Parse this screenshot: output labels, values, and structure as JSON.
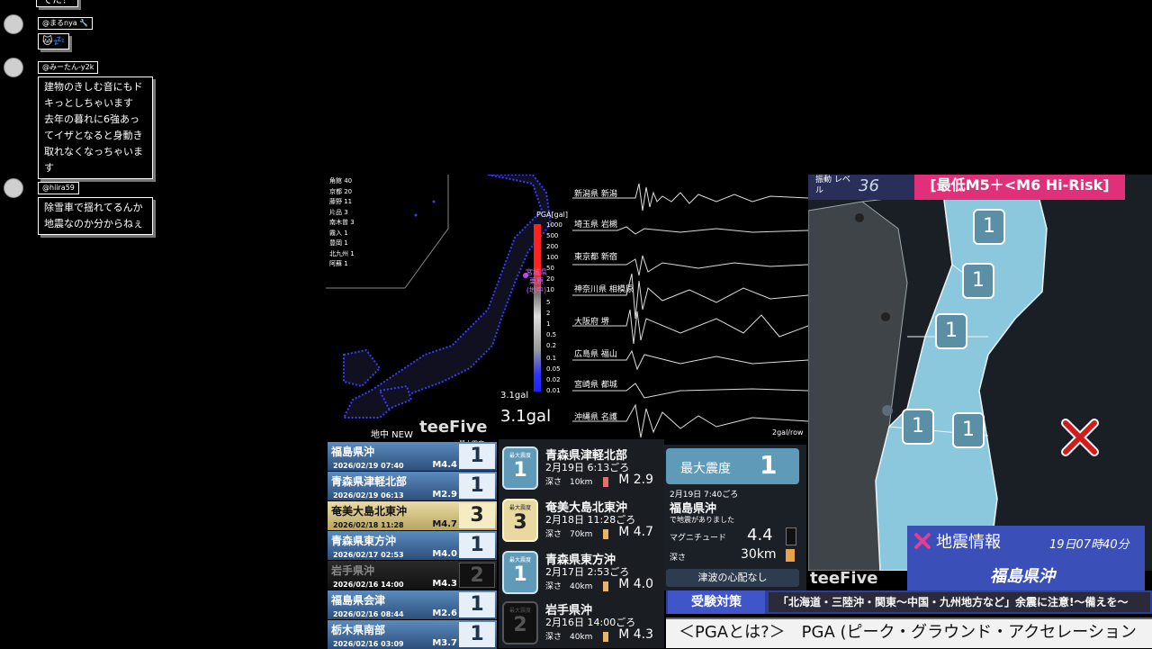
{
  "chat": {
    "top_fragment": "でた？",
    "messages": [
      {
        "user": "@まるnya 🔧",
        "text": "🐱💤"
      },
      {
        "user": "@みーたん-y2k",
        "text": "建物のきしむ音にもド\nキっとしちゃいます\n去年の暮れに6強あっ\nてイザとなると身動き\n取れなくなっちゃいま\nす"
      },
      {
        "user": "@hiira59",
        "text": "除雪車で揺れてるんか\n地震なのか分からねぇ"
      }
    ]
  },
  "map_panel": {
    "list": [
      "角館 40",
      "京都 20",
      "藤野 11",
      "片品 3",
      "南木曽 3",
      "霧入 1",
      "豊岡 1",
      "北九州 1",
      "阿蘇 1"
    ],
    "pga_label": "PGA[gal]",
    "ticks": [
      "1000",
      "500",
      "200",
      "100",
      "50",
      "20",
      "10",
      "5",
      "2",
      "1",
      "0.5",
      "0.2",
      "0.1",
      "0.05",
      "0.02",
      "0.01"
    ],
    "marker_label": "宮城県 栗原 (地中)",
    "small_gal": "3.1gal",
    "big_gal": "3.1gal",
    "footer_left": "地中 NEW",
    "brand": "teeFive"
  },
  "seismo": {
    "stations": [
      "新潟県 新潟",
      "埼玉県 岩槻",
      "東京都 新宿",
      "神奈川県 相模原",
      "大阪府 堺",
      "広島県 福山",
      "宮崎県 都城",
      "沖縄県 名護"
    ],
    "scale": "2gal/row"
  },
  "history": {
    "header_label": "最大震度",
    "rows": [
      {
        "place": "福島県沖",
        "date": "2026/02/19 07:40",
        "mag": "M4.4",
        "int": "1"
      },
      {
        "place": "青森県津軽北部",
        "date": "2026/02/19 06:13",
        "mag": "M2.9",
        "int": "1"
      },
      {
        "place": "奄美大島北東沖",
        "date": "2026/02/18 11:28",
        "mag": "M4.7",
        "int": "3"
      },
      {
        "place": "青森県東方沖",
        "date": "2026/02/17 02:53",
        "mag": "M4.0",
        "int": "1"
      },
      {
        "place": "岩手県沖",
        "date": "2026/02/16 14:00",
        "mag": "M4.3",
        "int": "2"
      },
      {
        "place": "福島県会津",
        "date": "2026/02/16 08:44",
        "mag": "M2.6",
        "int": "1"
      },
      {
        "place": "栃木県南部",
        "date": "2026/02/16 03:09",
        "mag": "M3.7",
        "int": "1"
      }
    ]
  },
  "cards": [
    {
      "int_label": "最大震度",
      "int": "1",
      "place": "青森県津軽北部",
      "time": "2月19日 6:13ごろ",
      "depth": "深さ　10km",
      "m": "M 2.9"
    },
    {
      "int_label": "最大震度",
      "int": "3",
      "place": "奄美大島北東沖",
      "time": "2月18日 11:28ごろ",
      "depth": "深さ　70km",
      "m": "M 4.7"
    },
    {
      "int_label": "最大震度",
      "int": "1",
      "place": "青森県東方沖",
      "time": "2月17日 2:53ごろ",
      "depth": "深さ　40km",
      "m": "M 4.0"
    },
    {
      "int_label": "最大震度",
      "int": "2",
      "place": "岩手県沖",
      "time": "2月16日 14:00ごろ",
      "depth": "深さ　40km",
      "m": "M 4.3"
    }
  ],
  "latest": {
    "max_label": "最大震度",
    "max_int": "1",
    "time": "2月19日 7:40ごろ",
    "place": "福島県沖",
    "sub": "で地震がありました",
    "mag_label": "マグニチュード",
    "mag": "4.4",
    "depth_label": "深さ",
    "depth": "30km",
    "tsunami": "津波の心配なし"
  },
  "right_map": {
    "level_label": "振動 レベル",
    "level_value": "36",
    "risk_banner": "[最低M5＋<M6 Hi-Risk]",
    "badges": [
      "1",
      "1",
      "1",
      "1",
      "1"
    ],
    "info_title": "地震情報",
    "info_time": "19日07時40分",
    "info_place": "福島県沖",
    "brand": "teeFive"
  },
  "ticker": {
    "tag": "受験対策",
    "message": "「北海道・三陸沖・関東～中国・九州地方など」余震に注意!～備えを～",
    "bottom": "＜PGAとは?＞　PGA (ピーク・グラウンド・アクセレーション"
  }
}
